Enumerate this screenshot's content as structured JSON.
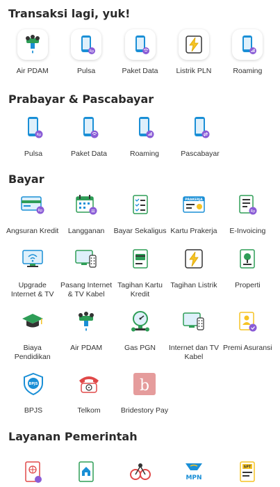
{
  "sections": [
    {
      "title": "Transaksi lagi, yuk!",
      "items": [
        {
          "label": "Air PDAM",
          "icon": "water-tap-icon"
        },
        {
          "label": "Pulsa",
          "icon": "phone-pulsa-icon"
        },
        {
          "label": "Paket Data",
          "icon": "phone-data-icon"
        },
        {
          "label": "Listrik PLN",
          "icon": "lightning-icon"
        },
        {
          "label": "Roaming",
          "icon": "phone-roaming-icon"
        }
      ]
    },
    {
      "title": "Prabayar & Pascabayar",
      "items": [
        {
          "label": "Pulsa",
          "icon": "phone-pulsa-icon"
        },
        {
          "label": "Paket Data",
          "icon": "phone-data-icon"
        },
        {
          "label": "Roaming",
          "icon": "phone-roaming-icon"
        },
        {
          "label": "Pascabayar",
          "icon": "phone-pascabayar-icon"
        }
      ]
    },
    {
      "title": "Bayar",
      "rows": [
        [
          "Angsuran Kredit",
          "Langganan",
          "Bayar Sekaligus",
          "Kartu Prakerja",
          "E-Invoicing"
        ],
        [
          "Upgrade Internet & TV",
          "Pasang Internet & TV Kabel",
          "Tagihan Kartu Kredit",
          "Tagihan Listrik",
          "Properti"
        ],
        [
          "Biaya Pendidikan",
          "Air PDAM",
          "Gas PGN",
          "Internet dan TV Kabel",
          "Premi Asuransi"
        ],
        [
          "BPJS",
          "Telkom",
          "Bridestory Pay"
        ]
      ],
      "prakerja_text": "PRAKERJA",
      "bpjs_text": "BPJS",
      "bridestory_letter": "b"
    },
    {
      "title": "Layanan Pemerintah",
      "mpn_text": "MPN",
      "spt_text": "SPT"
    }
  ],
  "colors": {
    "blue": "#1a8fd6",
    "green": "#2e9d57",
    "purple": "#8a5cd6",
    "yellow": "#f6c324",
    "red": "#e04848",
    "pink": "#e59c9c"
  }
}
